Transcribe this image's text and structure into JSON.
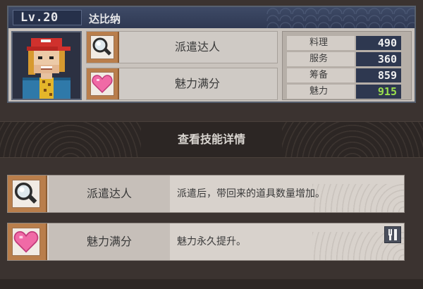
{
  "character": {
    "level": "Lv.20",
    "name": "达比纳"
  },
  "card_skills": [
    {
      "label": "派遣达人",
      "icon": "magnifier-icon"
    },
    {
      "label": "魅力满分",
      "icon": "heart-icon"
    }
  ],
  "stats": [
    {
      "name": "料理",
      "value": "490"
    },
    {
      "name": "服务",
      "value": "360"
    },
    {
      "name": "筹备",
      "value": "859"
    },
    {
      "name": "魅力",
      "value": "915",
      "highlight": "#9be04d"
    }
  ],
  "section": {
    "title": "查看技能详情"
  },
  "skill_details": [
    {
      "name": "派遣达人",
      "description": "派遣后，带回来的道具数量增加。",
      "icon": "magnifier-icon"
    },
    {
      "name": "魅力满分",
      "description": "魅力永久提升。",
      "icon": "heart-icon",
      "badge_icon": "utensils-icon"
    }
  ],
  "colors": {
    "header": "#2f3953",
    "icon_frame": "#b97e4b",
    "stat_value_bg": "#2e3850",
    "highlight_value": "#9be04d"
  }
}
